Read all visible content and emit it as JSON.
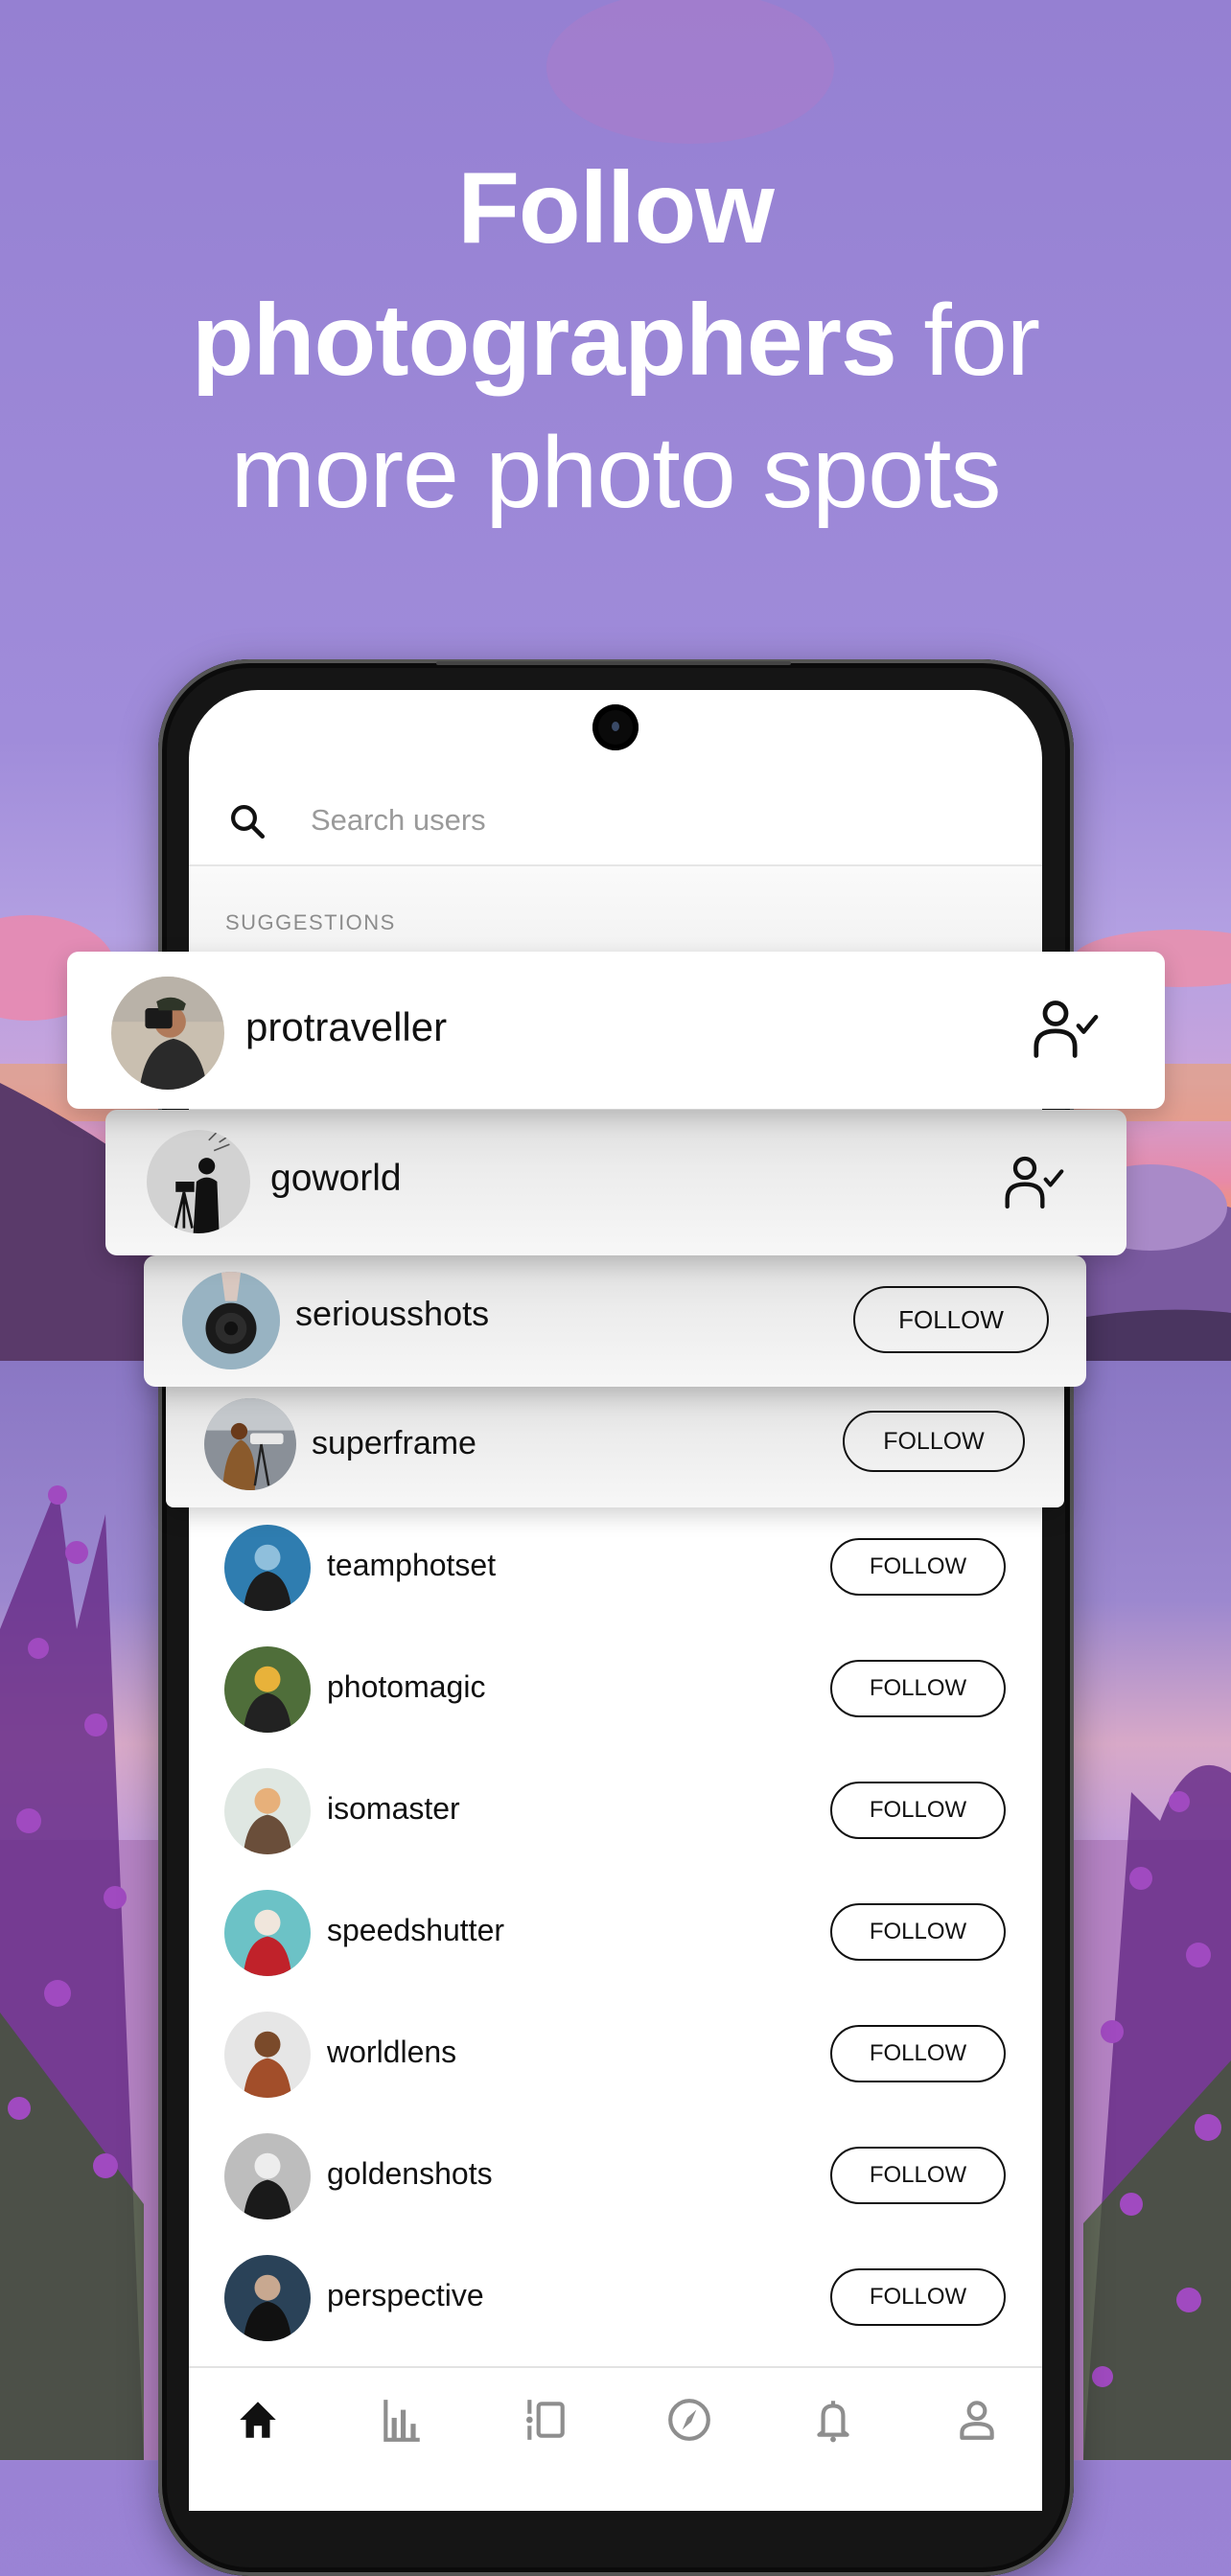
{
  "headline": {
    "line1_bold": "Follow",
    "line2_bold": "photographers",
    "line2_regular": " for",
    "line3_regular": "more photo spots"
  },
  "search": {
    "placeholder": "Search users",
    "value": "",
    "icon": "search-icon"
  },
  "suggestions_label": "SUGGESTIONS",
  "featured_cards": [
    {
      "username": "protraveller",
      "state": "following",
      "icon": "user-check-icon",
      "avatar_colors": [
        "#c9bfb0",
        "#2a2a2a",
        "#b07a5a"
      ]
    },
    {
      "username": "goworld",
      "state": "following",
      "icon": "user-check-icon",
      "avatar_colors": [
        "#d8d8d8",
        "#111111",
        "#9a9a9a"
      ]
    },
    {
      "username": "seriousshots",
      "state": "not_following",
      "button_label": "FOLLOW",
      "avatar_colors": [
        "#6f95aa",
        "#1a1a1a",
        "#c9d4da"
      ]
    },
    {
      "username": "superframe",
      "state": "not_following",
      "button_label": "FOLLOW",
      "avatar_colors": [
        "#7d8790",
        "#8a5a2c",
        "#d0d0d0"
      ]
    }
  ],
  "users": [
    {
      "username": "teamphotset",
      "button_label": "FOLLOW",
      "avatar_colors": [
        "#2f7db0",
        "#1c1c1c",
        "#8fbfdc"
      ]
    },
    {
      "username": "photomagic",
      "button_label": "FOLLOW",
      "avatar_colors": [
        "#4f6e3a",
        "#222222",
        "#e8b23a"
      ]
    },
    {
      "username": "isomaster",
      "button_label": "FOLLOW",
      "avatar_colors": [
        "#dfe7e2",
        "#6a4e3a",
        "#e7b07a"
      ]
    },
    {
      "username": "speedshutter",
      "button_label": "FOLLOW",
      "avatar_colors": [
        "#6cc2c6",
        "#c0222a",
        "#f0e6dc"
      ]
    },
    {
      "username": "worldlens",
      "button_label": "FOLLOW",
      "avatar_colors": [
        "#e6e6e6",
        "#a24e2a",
        "#7a4a2a"
      ]
    },
    {
      "username": "goldenshots",
      "button_label": "FOLLOW",
      "avatar_colors": [
        "#bdbdbd",
        "#1a1a1a",
        "#ededed"
      ]
    },
    {
      "username": "perspective",
      "button_label": "FOLLOW",
      "avatar_colors": [
        "#2a4258",
        "#111111",
        "#c8a890"
      ]
    }
  ],
  "bottom_nav": [
    {
      "name": "home",
      "icon": "home-icon",
      "active": true
    },
    {
      "name": "stats",
      "icon": "bar-chart-icon",
      "active": false
    },
    {
      "name": "feed",
      "icon": "feed-swipe-icon",
      "active": false
    },
    {
      "name": "explore",
      "icon": "compass-icon",
      "active": false
    },
    {
      "name": "notifications",
      "icon": "bell-icon",
      "active": false
    },
    {
      "name": "profile",
      "icon": "profile-icon",
      "active": false
    }
  ],
  "colors": {
    "active_nav": "#111111",
    "inactive_nav": "#8e8e8e",
    "sky_purple": "#9a82d4",
    "sunset_orange": "#f29a3a",
    "sunset_pink": "#e87ba6"
  }
}
